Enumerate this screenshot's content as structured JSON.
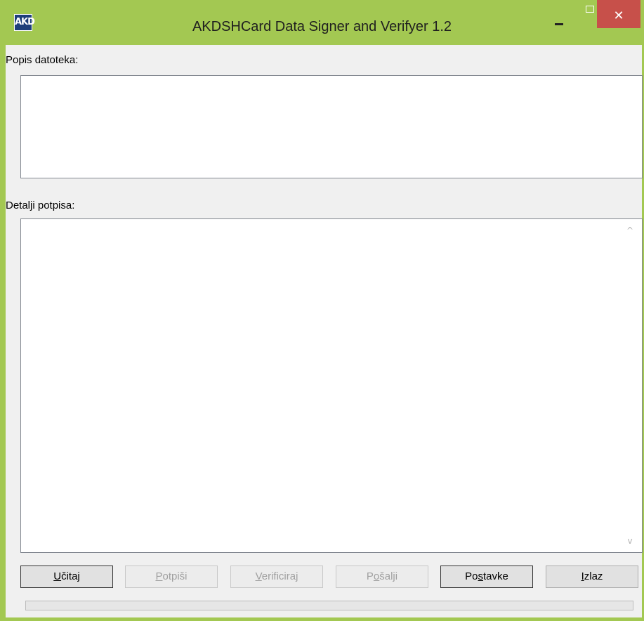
{
  "window": {
    "title": "AKDSHCard Data Signer and Verifyer 1.2",
    "icon": "akd-logo-icon",
    "icon_text": "AKD",
    "controls": {
      "minimize": "minimize-icon",
      "maximize": "maximize-icon",
      "close": "close-icon",
      "close_glyph": "✕"
    }
  },
  "files_section": {
    "label": "Popis datoteka:"
  },
  "details_section": {
    "label": "Detalji potpisa:",
    "scroll_up_glyph": "^",
    "scroll_down_glyph": "v"
  },
  "buttons": [
    {
      "name": "load-button",
      "label_pre": "",
      "label_hot": "U",
      "label_post": "čitaj",
      "enabled": true
    },
    {
      "name": "sign-button",
      "label_pre": "",
      "label_hot": "P",
      "label_post": "otpiši",
      "enabled": false
    },
    {
      "name": "verify-button",
      "label_pre": "",
      "label_hot": "V",
      "label_post": "erificiraj",
      "enabled": false
    },
    {
      "name": "send-button",
      "label_pre": "P",
      "label_hot": "o",
      "label_post": "šalji",
      "enabled": false
    },
    {
      "name": "settings-button",
      "label_pre": "Po",
      "label_hot": "s",
      "label_post": "tavke",
      "enabled": true
    },
    {
      "name": "exit-button",
      "label_pre": "",
      "label_hot": "I",
      "label_post": "zlaz",
      "enabled": true
    }
  ],
  "progress": {
    "value": 0
  },
  "colors": {
    "frame": "#a3c852",
    "close_button": "#c7504a",
    "progress_fill": "#06b025"
  }
}
